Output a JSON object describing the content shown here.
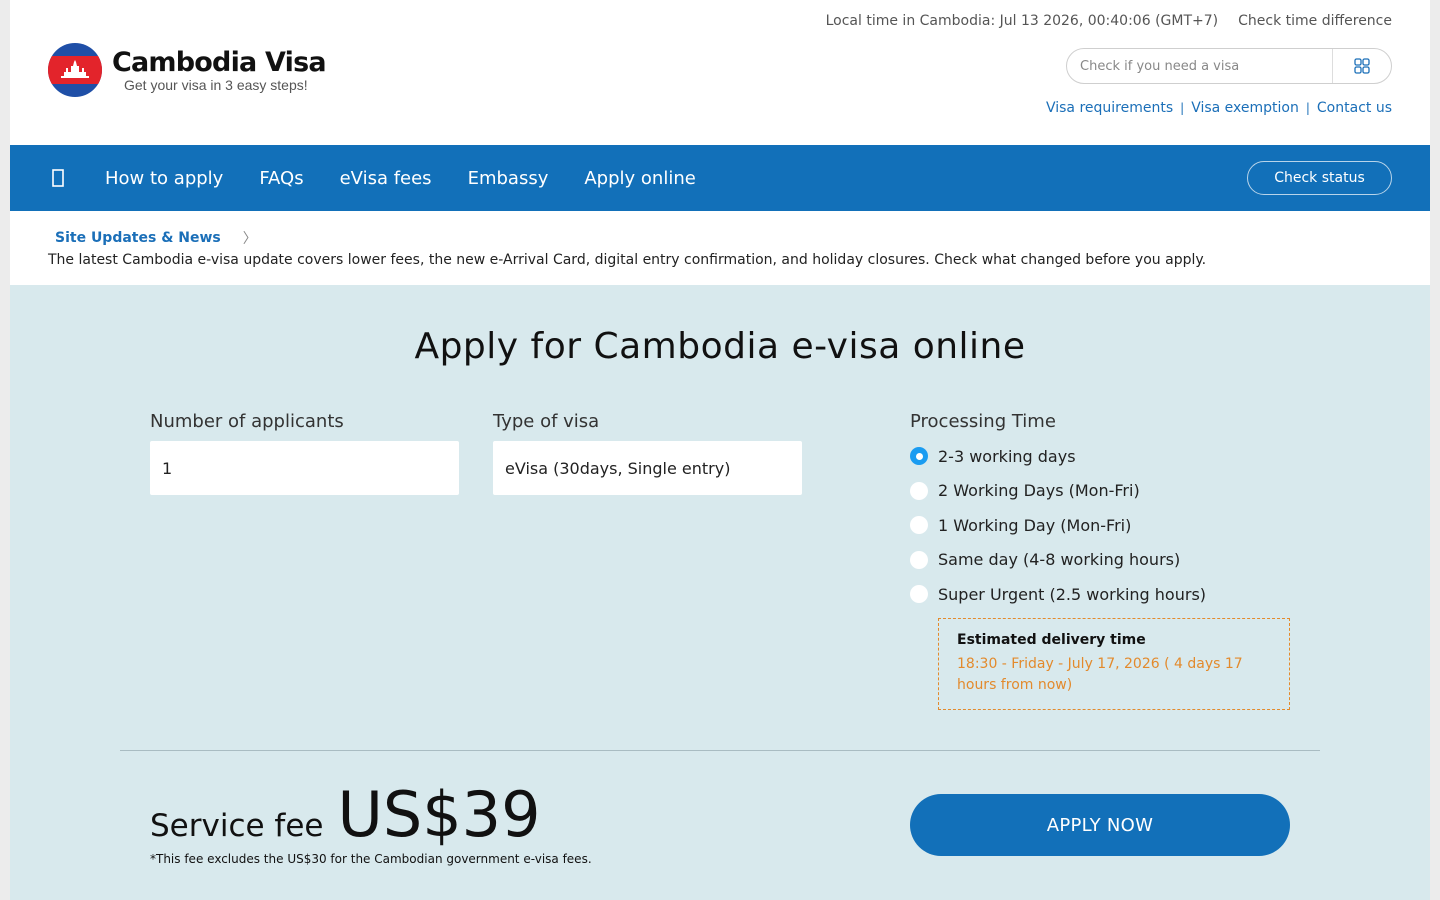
{
  "brand": {
    "title": "Cambodia Visa",
    "tagline": "Get your visa in 3 easy steps!"
  },
  "topbar": {
    "clock_icon": "",
    "local_time": "Local time in Cambodia: Jul 13 2026, 00:40:06 (GMT+7)",
    "time_diff": "Check time difference",
    "time_diff_icon": ""
  },
  "search": {
    "placeholder": "Check if you need a visa",
    "search_icon": ""
  },
  "top_links": [
    "Visa requirements",
    "Visa exemption",
    "Contact us"
  ],
  "nav": {
    "home_icon": "",
    "items": [
      "How to apply",
      "FAQs",
      "eVisa fees",
      "Embassy",
      "Apply online"
    ],
    "check_status": "Check status"
  },
  "news": {
    "bell_icon": "",
    "title": "Site Updates & News",
    "chevron": "〉",
    "text": "The latest Cambodia e-visa update covers lower fees, the new e-Arrival Card, digital entry confirmation, and holiday closures. Check what changed before you apply."
  },
  "form": {
    "title": "Apply for Cambodia e-visa online",
    "applicants_label": "Number of applicants",
    "applicants_value": "1",
    "visa_type_label": "Type of visa",
    "visa_type_value": "eVisa (30days, Single entry)",
    "select_arrow": "",
    "info_icon": "",
    "processing_label": "Processing Time",
    "processing_options": [
      {
        "label": "2-3 working days",
        "selected": true
      },
      {
        "label": "2 Working Days (Mon-Fri)",
        "selected": false
      },
      {
        "label": "1 Working Day (Mon-Fri)",
        "selected": false
      },
      {
        "label": "Same day (4-8 working hours)",
        "selected": false
      },
      {
        "label": "Super Urgent (2.5 working hours)",
        "selected": false
      }
    ],
    "delivery_heading": "Estimated delivery time",
    "delivery_text": "18:30 - Friday - July 17, 2026 ( 4 days 17 hours from now)"
  },
  "fee": {
    "label": "Service fee",
    "amount": "US$39",
    "note": "*This fee excludes the US$30 for the Cambodian government e-visa fees.",
    "apply_button": "APPLY NOW"
  },
  "colors": {
    "primary": "#1270b9",
    "accent_orange": "#e38a2c",
    "radio_selected": "#1a9cf1",
    "main_bg": "#d8e9ed"
  }
}
